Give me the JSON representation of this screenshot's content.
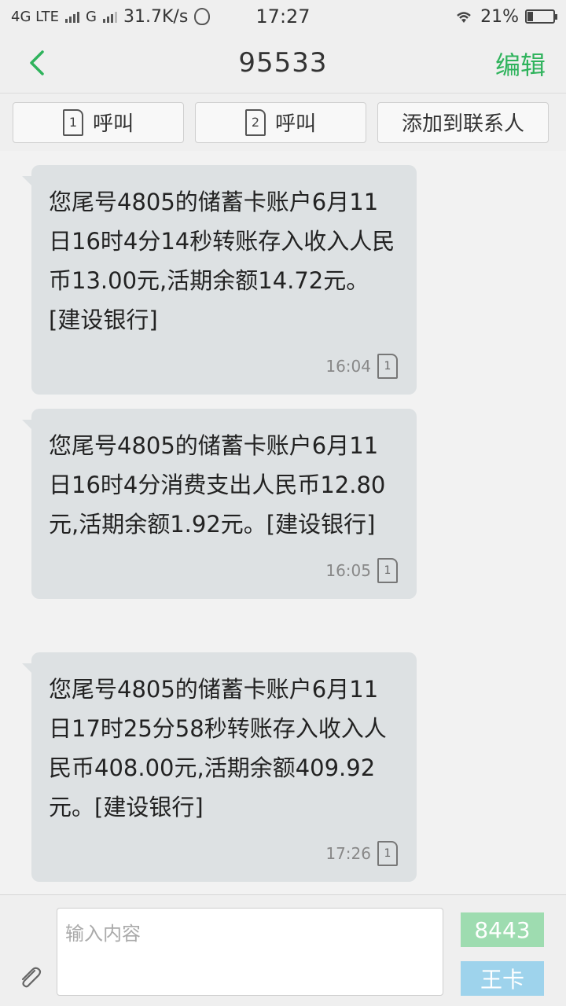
{
  "status_bar": {
    "network1": "4G LTE",
    "network2": "G",
    "speed": "31.7K/s",
    "time": "17:27",
    "battery": "21%",
    "battery_level": 0.21
  },
  "header": {
    "title": "95533",
    "edit_label": "编辑"
  },
  "actions": {
    "call1_sim": "1",
    "call1_label": "呼叫",
    "call2_sim": "2",
    "call2_label": "呼叫",
    "add_contact_label": "添加到联系人"
  },
  "messages": [
    {
      "text": "您尾号4805的储蓄卡账户6月11日16时4分14秒转账存入收入人民币13.00元,活期余额14.72元。[建设银行]",
      "time": "16:04",
      "sim": "1"
    },
    {
      "text": "您尾号4805的储蓄卡账户6月11日16时4分消费支出人民币12.80元,活期余额1.92元。[建设银行]",
      "time": "16:05",
      "sim": "1"
    },
    {
      "text": "您尾号4805的储蓄卡账户6月11日17时25分58秒转账存入收入人民币408.00元,活期余额409.92元。[建设银行]",
      "time": "17:26",
      "sim": "1"
    }
  ],
  "compose": {
    "placeholder": "输入内容",
    "send1_label": "8443",
    "send2_label": "王卡"
  },
  "colors": {
    "accent": "#2fb35c",
    "bubble": "#dde1e3",
    "send1": "#9edcb0",
    "send2": "#9ed3ec"
  }
}
